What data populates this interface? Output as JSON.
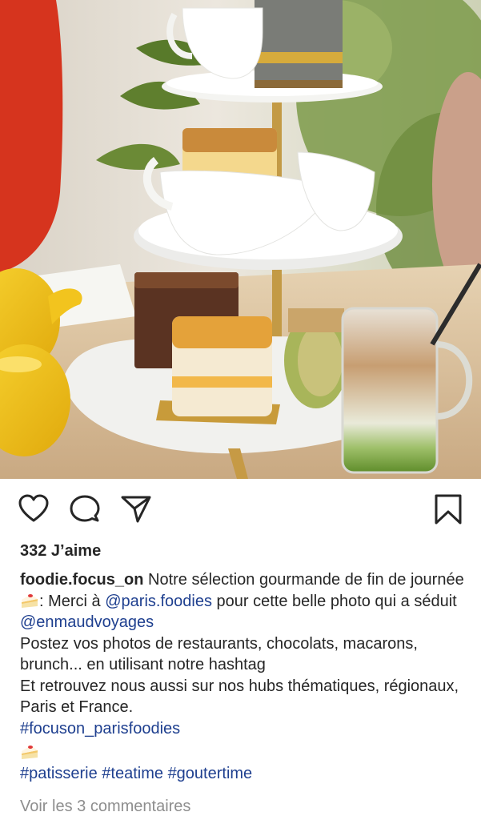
{
  "post": {
    "likes": "332 J’aime",
    "caption": {
      "username": "foodie.focus_on",
      "text1": " Notre sélection gourmande de fin de journée ",
      "text2": ": Merci à ",
      "mention1": "@paris.foodies",
      "text3": " pour cette belle photo qui a séduit ",
      "mention2": "@enmaudvoyages",
      "paragraph2": "Postez vos photos de restaurants, chocolats, macarons, brunch... en utilisant notre hashtag",
      "paragraph3": "Et retrouvez nous aussi sur nos hubs thématiques, régionaux, Paris et France.",
      "hashtag_main": "#focuson_parisfoodies",
      "hashtags": [
        "#patisserie",
        "#teatime",
        "#goutertime"
      ]
    },
    "view_comments": "Voir les 3 commentaires"
  },
  "icons": {
    "like": "heart-icon",
    "comment": "comment-bubble-icon",
    "share": "paper-plane-icon",
    "save": "bookmark-icon",
    "emoji": "cake-emoji-icon"
  },
  "colors": {
    "text": "#262626",
    "link": "#1e3f8f",
    "muted": "#8e8e8e"
  }
}
